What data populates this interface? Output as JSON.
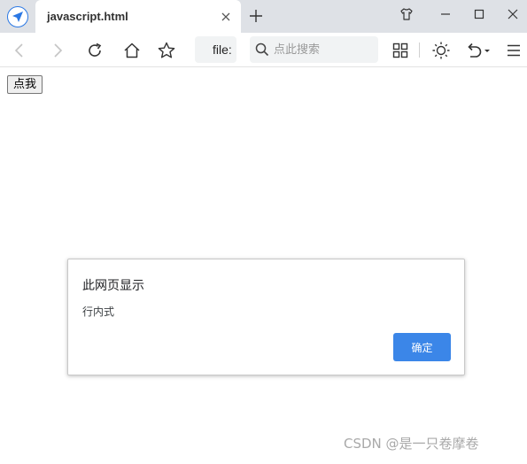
{
  "tab": {
    "title": "javascript.html"
  },
  "toolbar": {
    "address": "file:",
    "search_placeholder": "点此搜索"
  },
  "page": {
    "button_label": "点我"
  },
  "dialog": {
    "title": "此网页显示",
    "message": "行内式",
    "ok_label": "确定"
  },
  "watermark": "CSDN @是一只卷摩卷",
  "icons": {
    "browser": "compass-logo-icon",
    "close": "close-icon",
    "new_tab": "plus-icon",
    "skin": "shirt-icon",
    "minimize": "minimize-icon",
    "maximize": "maximize-icon",
    "back": "chevron-left-icon",
    "forward": "chevron-right-icon",
    "reload": "reload-icon",
    "home": "home-icon",
    "bookmark": "star-icon",
    "search": "search-icon",
    "apps": "grid-icon",
    "brightness": "sun-icon",
    "undo": "undo-icon",
    "menu": "hamburger-icon"
  },
  "colors": {
    "accent": "#3b86e8",
    "tabstrip": "#dee1e6"
  }
}
